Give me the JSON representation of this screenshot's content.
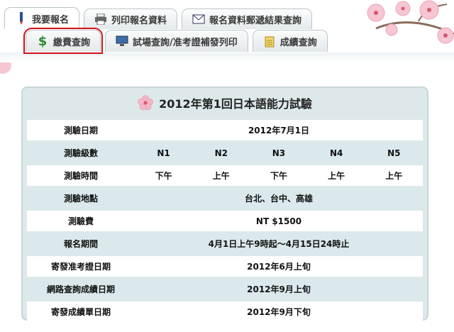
{
  "tabs_top": [
    {
      "label": "我要報名",
      "icon": "pen-icon"
    },
    {
      "label": "列印報名資料",
      "icon": "printer-icon"
    },
    {
      "label": "報名資料郵遞結果查詢",
      "icon": "envelope-icon"
    }
  ],
  "tabs_second": [
    {
      "label": "繳費查詢",
      "icon": "dollar-icon"
    },
    {
      "label": "試場查詢/准考證補發列印",
      "icon": "computer-icon"
    },
    {
      "label": "成績查詢",
      "icon": "notepad-icon"
    }
  ],
  "panel": {
    "title": "2012年第1回日本語能力試驗",
    "rows": [
      {
        "label": "測驗日期",
        "value": "2012年7月1日"
      },
      {
        "label": "測驗級數",
        "values": [
          "N1",
          "N2",
          "N3",
          "N4",
          "N5"
        ]
      },
      {
        "label": "測驗時間",
        "values": [
          "下午",
          "上午",
          "下午",
          "上午",
          "上午"
        ]
      },
      {
        "label": "測驗地點",
        "value": "台北、台中、高雄"
      },
      {
        "label": "測驗費",
        "value": "NT $1500"
      },
      {
        "label": "報名期間",
        "value": "4月1日上午9時起～4月15日24時止"
      },
      {
        "label": "寄發准考證日期",
        "value": "2012年6月上旬"
      },
      {
        "label": "網路查詢成績日期",
        "value": "2012年9月上旬"
      },
      {
        "label": "寄發成績單日期",
        "value": "2012年9月下旬"
      }
    ]
  },
  "colors": {
    "highlight": "#d0141a",
    "panel_bg": "#dde8ea",
    "row_alt": "#dbe9ec"
  }
}
